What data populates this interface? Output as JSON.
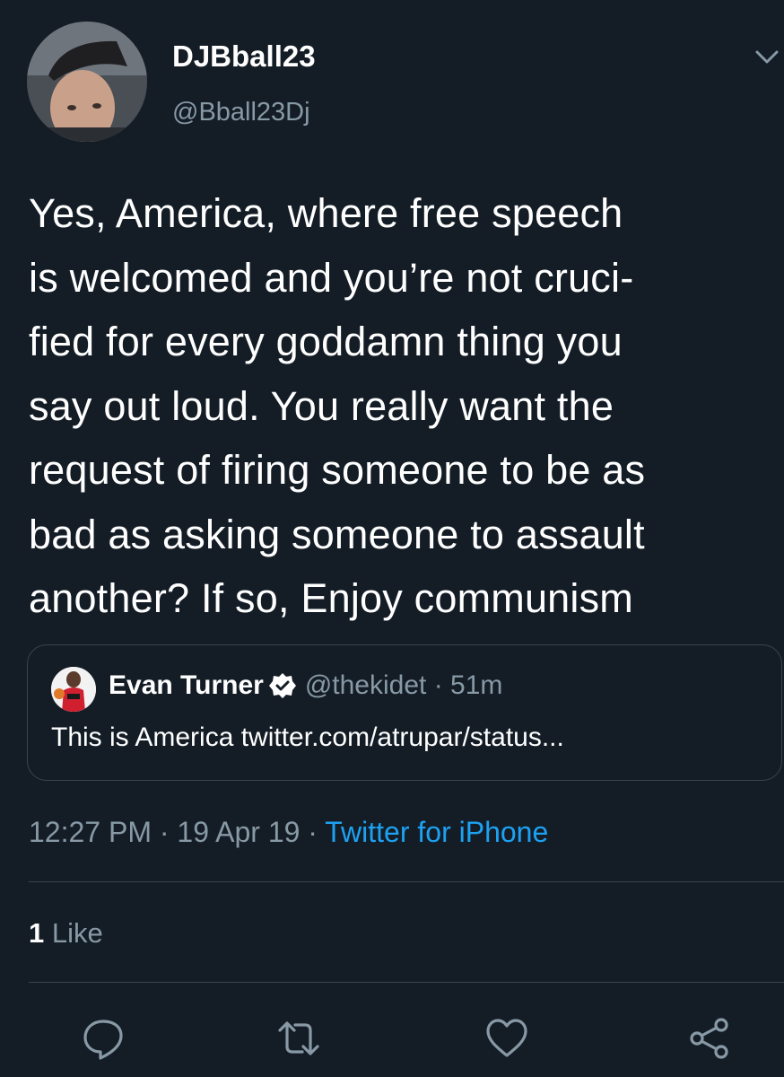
{
  "author": {
    "display_name": "DJBball23",
    "handle": "@Bball23Dj"
  },
  "tweet": {
    "lines": [
      "Yes, America, where free speech",
      "is welcomed and you’re not cruci-",
      "fied for every goddamn thing you",
      "say out loud. You really want the",
      "request of firing someone to be as",
      "bad as asking someone to assault",
      "another? If so, Enjoy communism"
    ]
  },
  "quoted_tweet": {
    "display_name": "Evan Turner",
    "handle_time": "@thekidet · 51m",
    "text": "This is America twitter.com/atrupar/status..."
  },
  "meta": {
    "time": "12:27 PM",
    "sep1": " · ",
    "date": "19 Apr 19",
    "sep2": " · ",
    "source": "Twitter for iPhone"
  },
  "stats": {
    "like_count": "1",
    "like_label": "Like"
  },
  "actions": [
    "reply-icon",
    "retweet-icon",
    "like-icon",
    "share-icon"
  ],
  "colors": {
    "background": "#141d26",
    "text": "#ffffff",
    "secondary": "#8899a6",
    "link": "#1da1f2",
    "border": "#38444d"
  }
}
